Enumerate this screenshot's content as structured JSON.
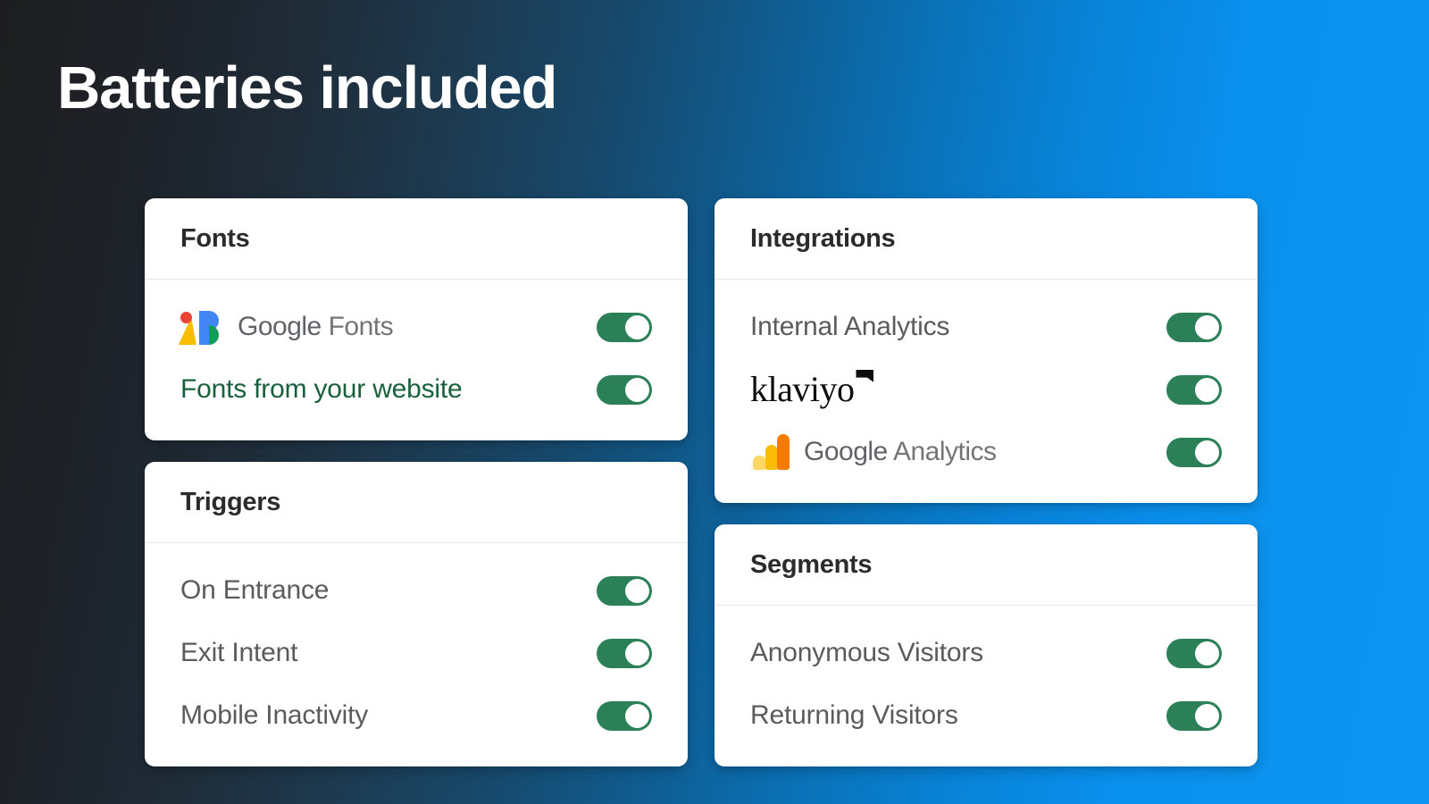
{
  "page": {
    "title": "Batteries included",
    "background_gradient_from": "#1d1d1f",
    "background_gradient_to": "#0c94f0",
    "toggle_on_color": "#2c8058",
    "heading_color": "#ffffff"
  },
  "cards": [
    {
      "id": "fonts",
      "title": "Fonts",
      "rows": [
        {
          "label": "Google Fonts",
          "logo": "google-fonts-logo",
          "logo_word1": "Google",
          "logo_word2": "Fonts",
          "toggle": "on",
          "label_color": "#5f6368"
        },
        {
          "label": "Fonts from your website",
          "logo": null,
          "toggle": "on",
          "label_color": "#19603c"
        }
      ]
    },
    {
      "id": "integrations",
      "title": "Integrations",
      "rows": [
        {
          "label": "Internal Analytics",
          "logo": null,
          "toggle": "on",
          "label_color": "#5b5b5b"
        },
        {
          "label": "klaviyo",
          "logo": "klaviyo-logo",
          "toggle": "on",
          "label_color": "#0d0d0d"
        },
        {
          "label": "Google Analytics",
          "logo": "google-analytics-logo",
          "logo_word1": "Google",
          "logo_word2": "Analytics",
          "toggle": "on",
          "label_color": "#5f6368"
        }
      ]
    },
    {
      "id": "triggers",
      "title": "Triggers",
      "rows": [
        {
          "label": "On Entrance",
          "logo": null,
          "toggle": "on",
          "label_color": "#5b5b5b"
        },
        {
          "label": "Exit Intent",
          "logo": null,
          "toggle": "on",
          "label_color": "#5b5b5b"
        },
        {
          "label": "Mobile Inactivity",
          "logo": null,
          "toggle": "on",
          "label_color": "#5b5b5b"
        }
      ]
    },
    {
      "id": "segments",
      "title": "Segments",
      "rows": [
        {
          "label": "Anonymous Visitors",
          "logo": null,
          "toggle": "on",
          "label_color": "#5b5b5b"
        },
        {
          "label": "Returning Visitors",
          "logo": null,
          "toggle": "on",
          "label_color": "#5b5b5b"
        }
      ]
    }
  ]
}
